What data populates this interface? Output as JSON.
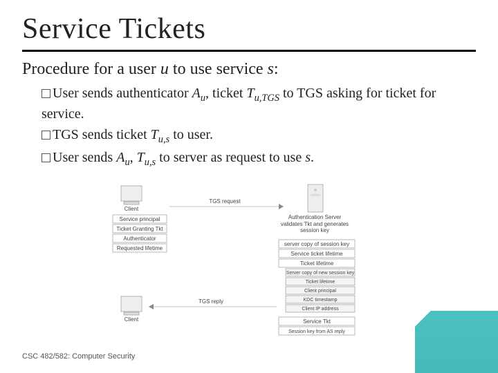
{
  "title": "Service Tickets",
  "subtitle_pre": "Procedure for a user ",
  "subtitle_u": "u",
  "subtitle_mid": " to use service ",
  "subtitle_s": "s",
  "subtitle_post": ":",
  "b1_t1": "User sends authenticator ",
  "b1_A": "A",
  "b1_Au": "u",
  "b1_t2": ", ticket ",
  "b1_T": "T",
  "b1_Tsub": "u,TGS",
  "b1_t3": " to TGS asking for ticket for service.",
  "b2_t1": "TGS sends ticket ",
  "b2_T": "T",
  "b2_Tsub": "u,s",
  "b2_t2": " to user.",
  "b3_t1": "User sends ",
  "b3_A": "A",
  "b3_Au": "u",
  "b3_t2": ", ",
  "b3_T": "T",
  "b3_Tsub": "u,s",
  "b3_t3": " to server as request to use ",
  "b3_s": "s",
  "b3_t4": ".",
  "footer": "CSC 482/582: Computer Security",
  "diagram": {
    "client_label": "Client",
    "client_box1": "Service principal",
    "client_box2": "Ticket Granting Tkt",
    "client_box3": "Authenticator",
    "client_box4": "Requested lifetime",
    "arrow_top": "TGS request",
    "as_label": "Authentication Server",
    "as_text": "validates Tkt and generates session key",
    "reply_r1": "server copy of session key",
    "reply_r2": "Service ticket lifetime",
    "reply_r3": "Ticket lifetime",
    "reply_inner1": "Server copy of new session key",
    "reply_inner2": "Ticket lifetime",
    "reply_inner3": "Client principal",
    "reply_inner4": "KDC timestamp",
    "reply_inner5": "Client IP address",
    "arrow_bot": "TGS reply",
    "client2_label": "Client",
    "bottom_r1": "Service Tkt",
    "bottom_r2": "Session key from AS reply"
  }
}
